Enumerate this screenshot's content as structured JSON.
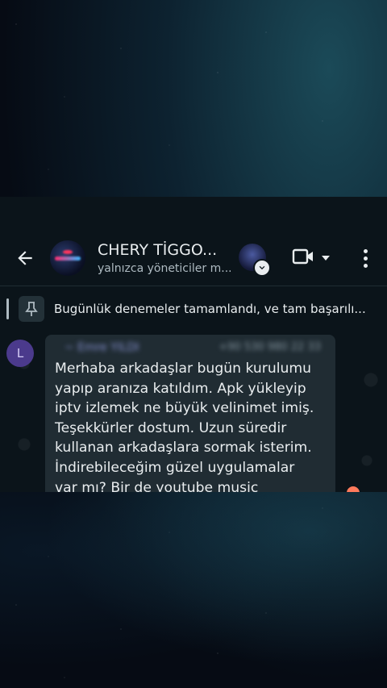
{
  "header": {
    "group_name": "CHERY TİGGO...",
    "subtitle": "yalnızca yöneticiler m..."
  },
  "pinned": {
    "text": "Bugünlük denemeler tamamlandı, ve tam başarılı..."
  },
  "message": {
    "avatar_letter": "L",
    "sender_name": "~ Emre YILDI",
    "sender_phone": "+90 530 980 22 33",
    "text": "Merhaba arkadaşlar bugün kurulumu\nyapıp aranıza katıldım. Apk yükleyip\niptv izlemek ne büyük velinimet imiş.\nTeşekkürler dostum. Uzun süredir\nkullanan arkadaşlara sormak isterim.\nİndirebileceğim güzel uygulamalar\nvar mı? Bir de youtube music"
  },
  "colors": {
    "header_bg": "#0b141a",
    "bubble_bg": "#202c33",
    "text": "#e9edef",
    "secondary": "#aebac1"
  },
  "icons": [
    "back-arrow-icon",
    "video-call-icon",
    "chevron-down-icon",
    "more-vert-icon",
    "pin-icon"
  ]
}
